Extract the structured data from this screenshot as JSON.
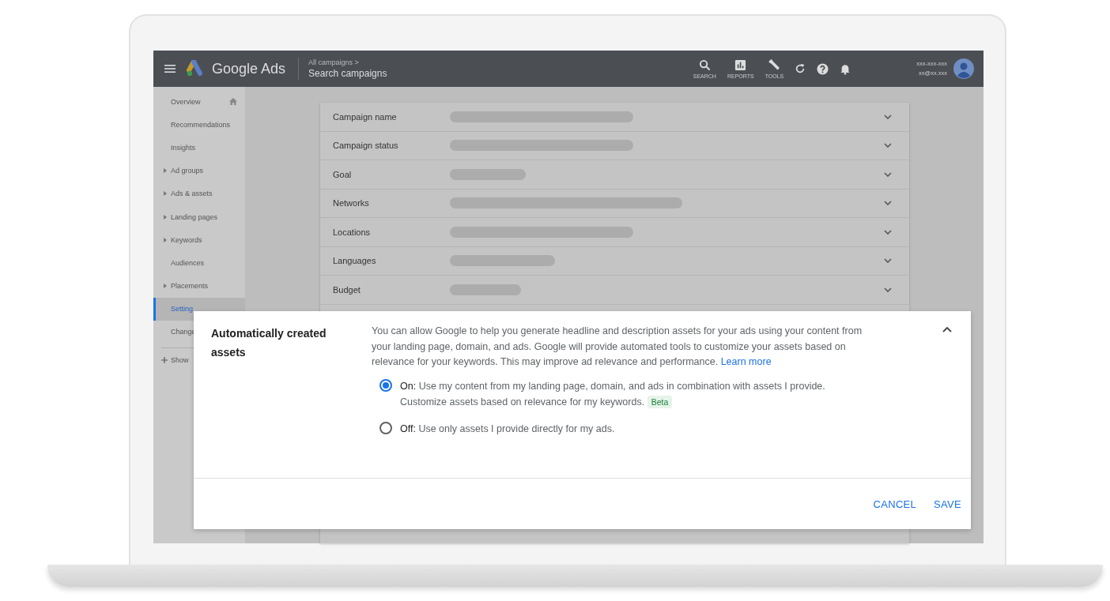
{
  "header": {
    "product": "Google Ads",
    "breadcrumb": "All campaigns >",
    "title": "Search campaigns",
    "tools": [
      {
        "kind": "search",
        "label": "SEARCH"
      },
      {
        "kind": "reports",
        "label": "REPORTS"
      },
      {
        "kind": "tools",
        "label": "TOOLS"
      },
      {
        "kind": "refresh"
      },
      {
        "kind": "help"
      },
      {
        "kind": "bell"
      }
    ],
    "account": {
      "id": "xxx-xxx-xxx",
      "email": "xx@xx.xxx"
    }
  },
  "sidebar": {
    "items": [
      {
        "label": "Overview",
        "expandable": false,
        "selected": false,
        "home": true
      },
      {
        "label": "Recommendations",
        "expandable": false,
        "selected": false
      },
      {
        "label": "Insights",
        "expandable": false,
        "selected": false
      },
      {
        "label": "Ad groups",
        "expandable": true,
        "selected": false
      },
      {
        "label": "Ads & assets",
        "expandable": true,
        "selected": false
      },
      {
        "label": "Landing pages",
        "expandable": true,
        "selected": false
      },
      {
        "label": "Keywords",
        "expandable": true,
        "selected": false
      },
      {
        "label": "Audiences",
        "expandable": false,
        "selected": false
      },
      {
        "label": "Placements",
        "expandable": true,
        "selected": false
      },
      {
        "label": "Setting",
        "expandable": false,
        "selected": true
      },
      {
        "label": "Change",
        "expandable": false,
        "selected": false
      }
    ],
    "show_more": "Show"
  },
  "settings": [
    {
      "label": "Campaign name"
    },
    {
      "label": "Campaign status"
    },
    {
      "label": "Goal"
    },
    {
      "label": "Networks"
    },
    {
      "label": "Locations"
    },
    {
      "label": "Languages"
    },
    {
      "label": "Budget"
    }
  ],
  "dialog": {
    "title": "Automatically created assets",
    "description": "You can allow Google to help you generate headline and description assets for your ads using your content from your landing page, domain, and ads. Google will provide automated tools to customize your assets based on relevance for your keywords. This may improve ad relevance and performance.",
    "link": "Learn more",
    "options": [
      {
        "label": "On:",
        "text": "Use my content from my landing page, domain, and ads in combination with assets I provide. Customize assets based on relevance for my keywords.",
        "badge": "Beta",
        "selected": true
      },
      {
        "label": "Off:",
        "text": "Use only assets I provide directly for my ads.",
        "selected": false
      }
    ],
    "buttons": [
      "CANCEL",
      "SAVE"
    ]
  }
}
